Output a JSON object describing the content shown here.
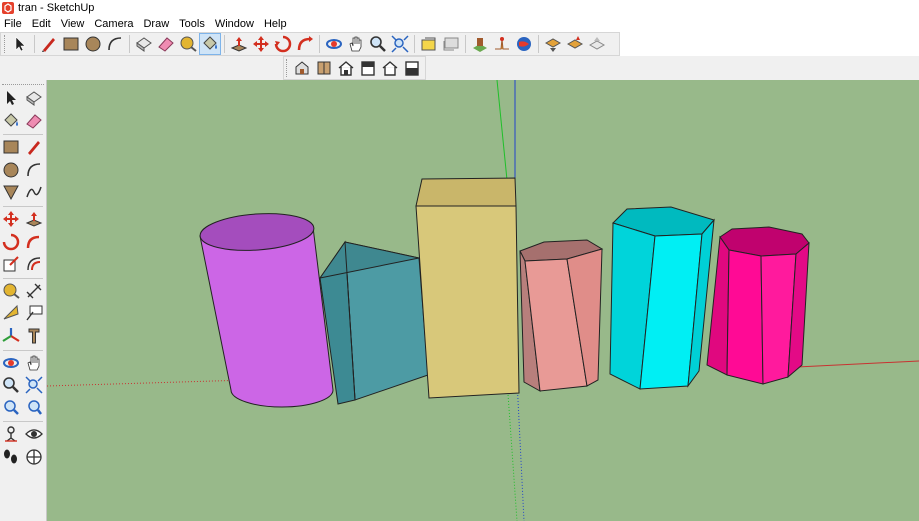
{
  "window": {
    "title": "tran - SketchUp"
  },
  "menu": {
    "items": [
      {
        "label": "File"
      },
      {
        "label": "Edit"
      },
      {
        "label": "View"
      },
      {
        "label": "Camera"
      },
      {
        "label": "Draw"
      },
      {
        "label": "Tools"
      },
      {
        "label": "Window"
      },
      {
        "label": "Help"
      }
    ]
  },
  "toolbar_main": {
    "groups": [
      [
        "select",
        "line",
        "rectangle",
        "circle",
        "arc"
      ],
      [
        "make-component",
        "eraser",
        "tape-measure",
        "paint-bucket"
      ],
      [
        "push-pull",
        "move",
        "rotate",
        "follow-me"
      ],
      [
        "orbit",
        "pan",
        "zoom",
        "zoom-extents"
      ],
      [
        "previous-view",
        "next-view"
      ],
      [
        "add-location",
        "toggle-terrain",
        "get-models"
      ],
      [
        "share-model",
        "extension-warehouse",
        "3d-warehouse-upload"
      ]
    ],
    "active_tool": "paint-bucket"
  },
  "toolbar_views": {
    "buttons": [
      "iso-view",
      "top-view",
      "front-view",
      "right-view",
      "back-view",
      "left-view"
    ]
  },
  "toolbar_left": {
    "buttons": [
      "select",
      "make-component",
      "paint-bucket",
      "eraser",
      "rectangle",
      "line",
      "circle",
      "arc",
      "polygon",
      "freehand",
      "move",
      "push-pull",
      "rotate",
      "follow-me",
      "scale",
      "offset",
      "tape-measure",
      "text",
      "protractor",
      "dimension",
      "axes",
      "3d-text",
      "orbit",
      "pan",
      "zoom",
      "zoom-window",
      "zoom-extents",
      "previous-view",
      "position-camera",
      "look-around",
      "walk",
      "section-plane"
    ]
  },
  "scene": {
    "background": "#98b98a",
    "objects": [
      {
        "name": "cylinder",
        "color": "#cc66e6"
      },
      {
        "name": "triangular-prism",
        "color": "#4d9ba4"
      },
      {
        "name": "box",
        "color": "#d8c87a"
      },
      {
        "name": "pentagonal-prism",
        "color": "#e89a96"
      },
      {
        "name": "hexagonal-prism",
        "color": "#00e5ea"
      },
      {
        "name": "octagonal-prism",
        "color": "#ff0a95"
      }
    ]
  }
}
